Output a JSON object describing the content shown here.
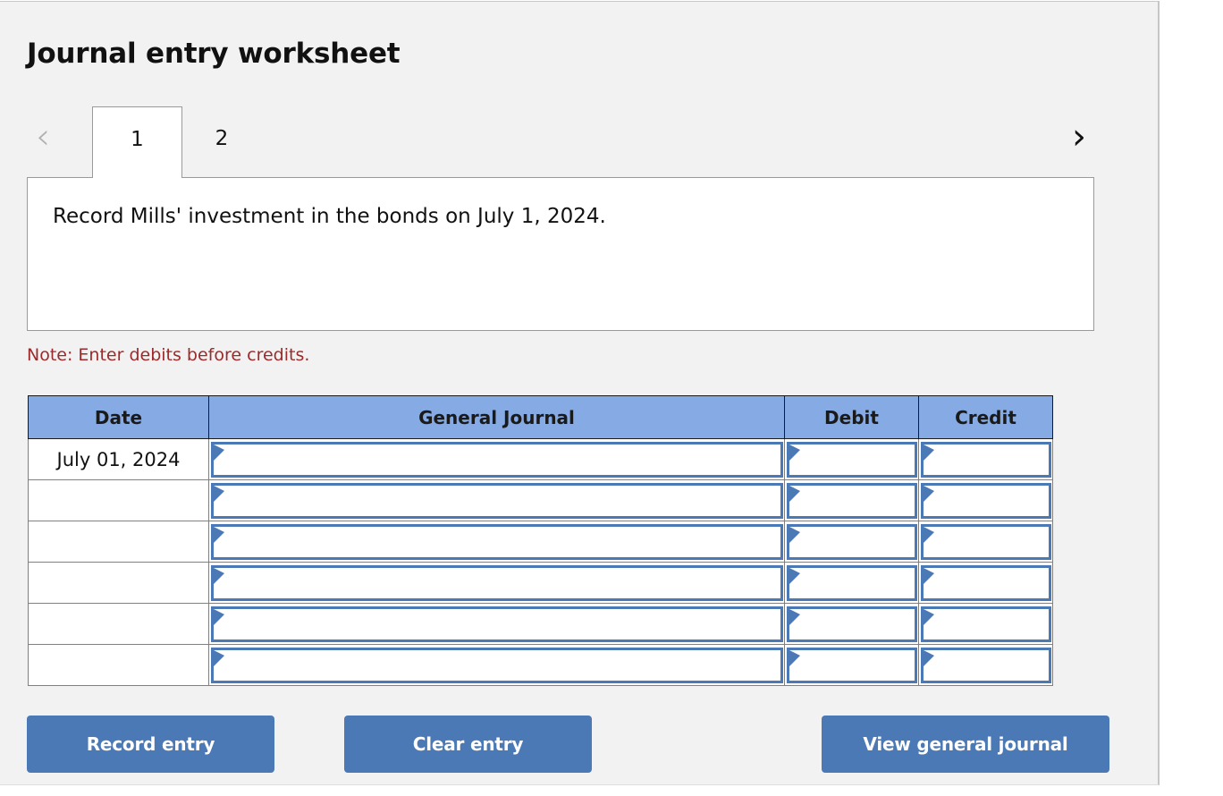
{
  "page": {
    "title": "Journal entry worksheet"
  },
  "tabs": {
    "prev_icon": "chevron-left-icon",
    "prev_glyph": "‹",
    "next_icon": "chevron-right-icon",
    "next_glyph": "›",
    "items": [
      {
        "label": "1",
        "active": true
      },
      {
        "label": "2",
        "active": false
      }
    ]
  },
  "prompt": {
    "text": "Record Mills' investment in the bonds on July 1, 2024."
  },
  "note": {
    "text": "Note: Enter debits before credits."
  },
  "table": {
    "headers": [
      "Date",
      "General Journal",
      "Debit",
      "Credit"
    ],
    "rows": [
      {
        "date": "July 01, 2024",
        "general_journal": "",
        "debit": "",
        "credit": ""
      },
      {
        "date": "",
        "general_journal": "",
        "debit": "",
        "credit": ""
      },
      {
        "date": "",
        "general_journal": "",
        "debit": "",
        "credit": ""
      },
      {
        "date": "",
        "general_journal": "",
        "debit": "",
        "credit": ""
      },
      {
        "date": "",
        "general_journal": "",
        "debit": "",
        "credit": ""
      },
      {
        "date": "",
        "general_journal": "",
        "debit": "",
        "credit": ""
      }
    ]
  },
  "buttons": {
    "record": "Record entry",
    "clear": "Clear entry",
    "view": "View general journal"
  },
  "colors": {
    "header_blue": "#86aae3",
    "button_blue": "#4a79b5",
    "note_red": "#9c2a2a",
    "panel_bg": "#f2f2f2",
    "combo_border": "#4a79b5"
  }
}
